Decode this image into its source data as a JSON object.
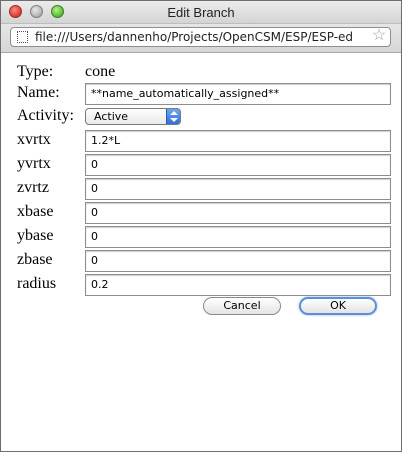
{
  "window": {
    "title": "Edit Branch",
    "url": "file:///Users/dannenho/Projects/OpenCSM/ESP/ESP-ed"
  },
  "form": {
    "type_label": "Type:",
    "type_value": "cone",
    "name_label": "Name:",
    "name_value": "**name_automatically_assigned**",
    "activity_label": "Activity:",
    "activity_value": "Active",
    "params": [
      {
        "label": "xvrtx",
        "value": "1.2*L"
      },
      {
        "label": "yvrtx",
        "value": "0"
      },
      {
        "label": "zvrtz",
        "value": "0"
      },
      {
        "label": "xbase",
        "value": "0"
      },
      {
        "label": "ybase",
        "value": "0"
      },
      {
        "label": "zbase",
        "value": "0"
      },
      {
        "label": "radius",
        "value": "0.2"
      }
    ]
  },
  "buttons": {
    "cancel": "Cancel",
    "ok": "OK"
  },
  "icons": {
    "page": "page-icon",
    "bookmark": "star-icon"
  }
}
